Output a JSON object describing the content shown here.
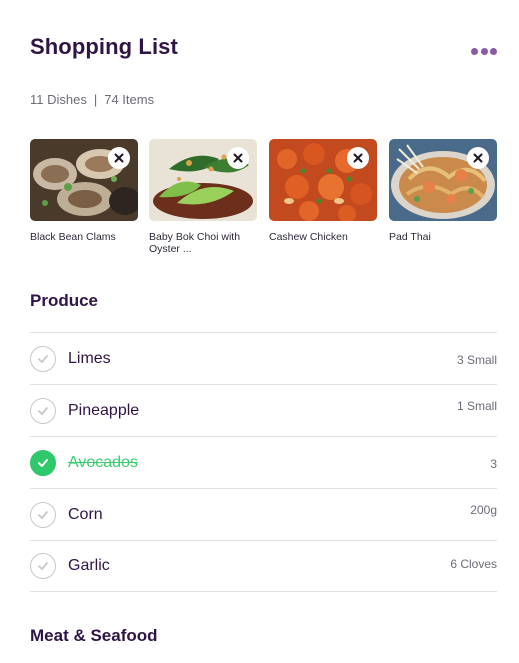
{
  "header": {
    "title": "Shopping List",
    "more_icon": "more-horizontal-icon",
    "accent_color": "#8a5aa7"
  },
  "meta": {
    "dishes": "11 Dishes",
    "separator": "|",
    "items": "74 Items"
  },
  "dishes": [
    {
      "name": "Black Bean Clams",
      "remove_icon": "close-icon"
    },
    {
      "name": "Baby Bok Choi with Oyster ...",
      "remove_icon": "close-icon"
    },
    {
      "name": "Cashew Chicken",
      "remove_icon": "close-icon"
    },
    {
      "name": "Pad Thai",
      "remove_icon": "close-icon"
    }
  ],
  "sections": {
    "produce": "Produce",
    "meat": "Meat & Seafood"
  },
  "produce_items": [
    {
      "name": "Limes",
      "qty": "3 Small",
      "checked": false
    },
    {
      "name": "Pineapple",
      "qty": "1 Small",
      "checked": false
    },
    {
      "name": "Avocados",
      "qty": "3",
      "checked": true
    },
    {
      "name": "Corn",
      "qty": "200g",
      "checked": false
    },
    {
      "name": "Garlic",
      "qty": "6 Cloves",
      "checked": false
    }
  ],
  "colors": {
    "checked_green": "#2fc86b",
    "title_purple": "#2f1545"
  }
}
